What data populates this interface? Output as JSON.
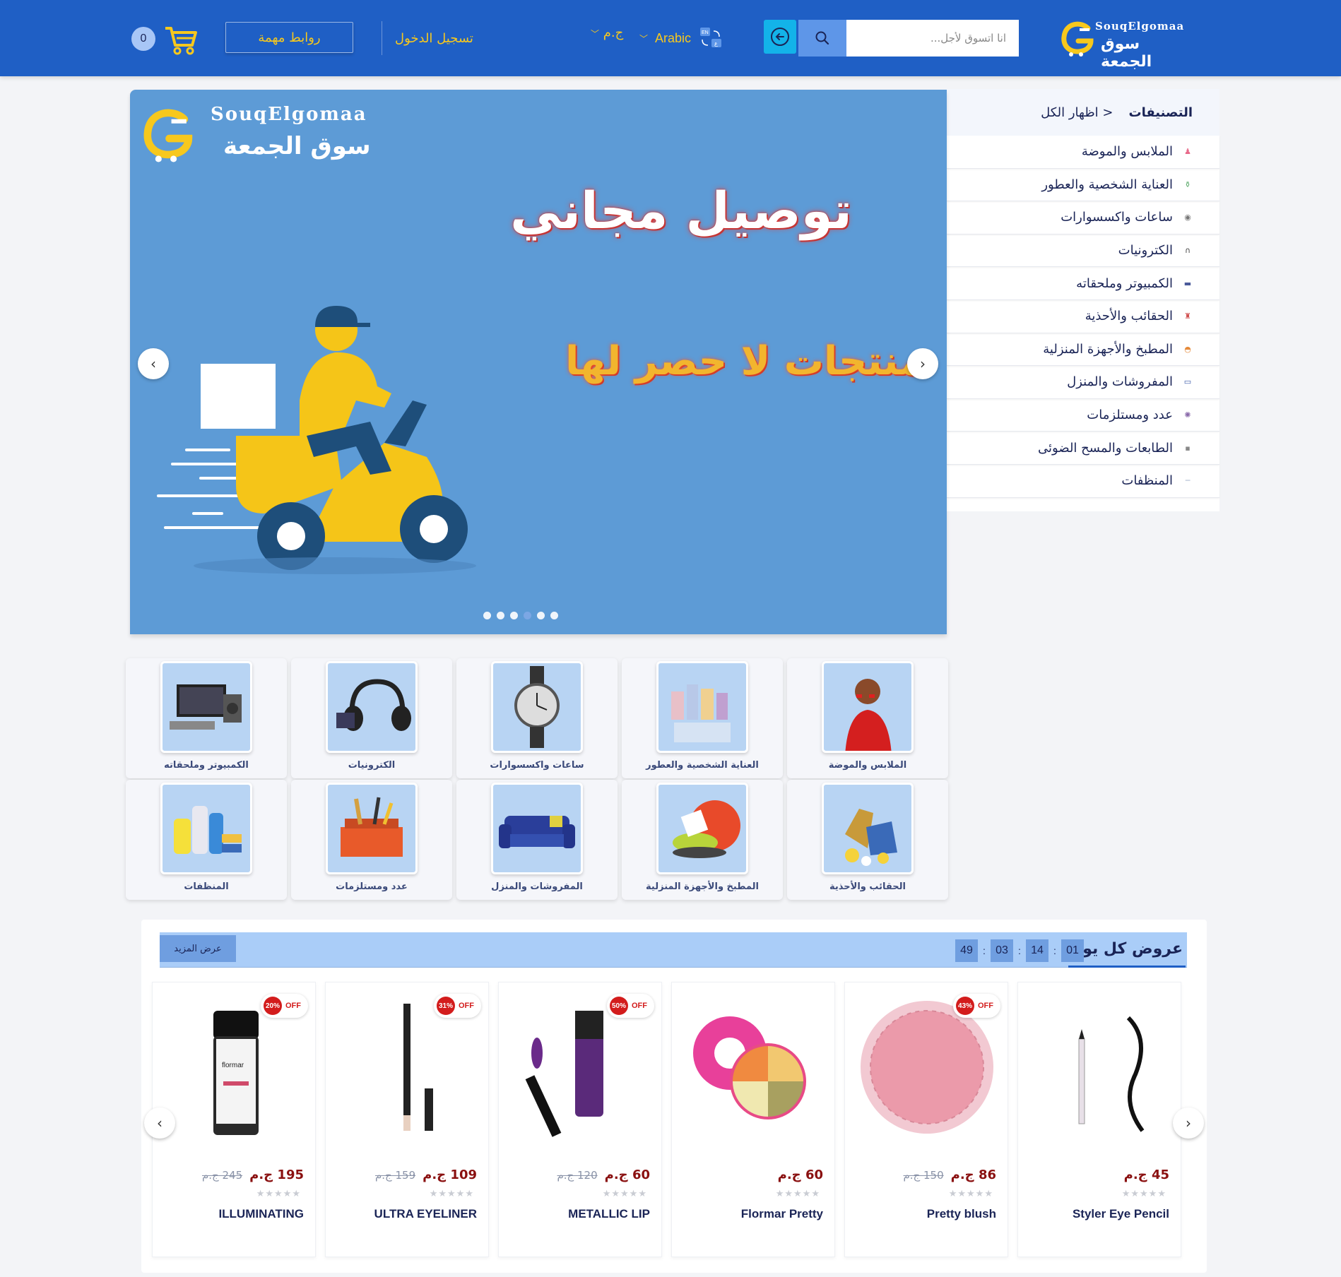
{
  "header": {
    "logo_en": "SouqElgomaa",
    "logo_ar": "سوق الجمعة",
    "search_placeholder": "انا اتسوق لأجل...",
    "language": "Arabic",
    "currency": "ج.م",
    "login": "تسجيل الدخول",
    "links_button": "روابط مهمة",
    "cart_count": "0"
  },
  "sidebar": {
    "title": "التصنيفات",
    "show_all": "اظهار الكل >",
    "items": [
      {
        "label": "الملابس والموضة",
        "icon": "dress-icon"
      },
      {
        "label": "العناية الشخصية والعطور",
        "icon": "perfume-icon"
      },
      {
        "label": "ساعات واكسسوارات",
        "icon": "watch-icon"
      },
      {
        "label": "الكترونيات",
        "icon": "headphones-icon"
      },
      {
        "label": "الكمبيوتر وملحقاته",
        "icon": "monitor-icon"
      },
      {
        "label": "الحقائب والأحذية",
        "icon": "bag-icon"
      },
      {
        "label": "المطبخ والأجهزة المنزلية",
        "icon": "pot-icon"
      },
      {
        "label": "المفروشات والمنزل",
        "icon": "sofa-icon"
      },
      {
        "label": "عدد ومستلزمات",
        "icon": "tools-icon"
      },
      {
        "label": "الطابعات والمسح الضوئى",
        "icon": "printer-icon"
      },
      {
        "label": "المنظفات",
        "icon": "cleaning-icon"
      }
    ]
  },
  "slider": {
    "logo_en": "SouqElgomaa",
    "logo_ar": "سوق الجمعة",
    "title": "توصيل مجاني",
    "subtitle": "منتجات لا حصر لها",
    "dot_count": 6,
    "active_dot": 3
  },
  "tiles": [
    {
      "label": "الملابس والموضة",
      "icon": "fashion-image"
    },
    {
      "label": "العناية الشخصية والعطور",
      "icon": "perfume-image"
    },
    {
      "label": "ساعات واكسسوارات",
      "icon": "watch-image"
    },
    {
      "label": "الكترونيات",
      "icon": "headphones-image"
    },
    {
      "label": "الكمبيوتر وملحقاته",
      "icon": "computer-image"
    },
    {
      "label": "الحقائب والأحذية",
      "icon": "bags-image"
    },
    {
      "label": "المطبخ والأجهزة المنزلية",
      "icon": "kitchen-image"
    },
    {
      "label": "المفروشات والمنزل",
      "icon": "sofa-image"
    },
    {
      "label": "عدد ومستلزمات",
      "icon": "toolbox-image"
    },
    {
      "label": "المنظفات",
      "icon": "cleaning-image"
    }
  ],
  "deals": {
    "title": "عروض كل يوم",
    "timer": [
      "01",
      "14",
      "03",
      "49"
    ],
    "more_button": "عرض المزيد",
    "products": [
      {
        "name": "Styler Eye Pencil",
        "price": "45 ج.م",
        "old_price": "",
        "discount": "",
        "image": "eye-pencil-image"
      },
      {
        "name": "Pretty blush",
        "price": "86 ج.م",
        "old_price": "150 ج.م",
        "discount": "43%",
        "image": "blush-image"
      },
      {
        "name": "Flormar Pretty",
        "price": "60 ج.م",
        "old_price": "",
        "discount": "",
        "image": "eyeshadow-image"
      },
      {
        "name": "METALLIC LIP",
        "price": "60 ج.م",
        "old_price": "120 ج.م",
        "discount": "50%",
        "image": "lip-image"
      },
      {
        "name": "ULTRA EYELINER",
        "price": "109 ج.م",
        "old_price": "159 ج.م",
        "discount": "31%",
        "image": "eyeliner-image"
      },
      {
        "name": "ILLUMINATING",
        "price": "195 ج.م",
        "old_price": "245 ج.م",
        "discount": "20%",
        "image": "primer-image"
      }
    ],
    "off_label": "OFF",
    "stars": "★★★★★"
  },
  "colors": {
    "header": "#1f5fc5",
    "accent": "#f7c81d",
    "slider_bg": "#5d9bd6",
    "deals_bar": "#aacdf8",
    "price": "#8a1010"
  }
}
